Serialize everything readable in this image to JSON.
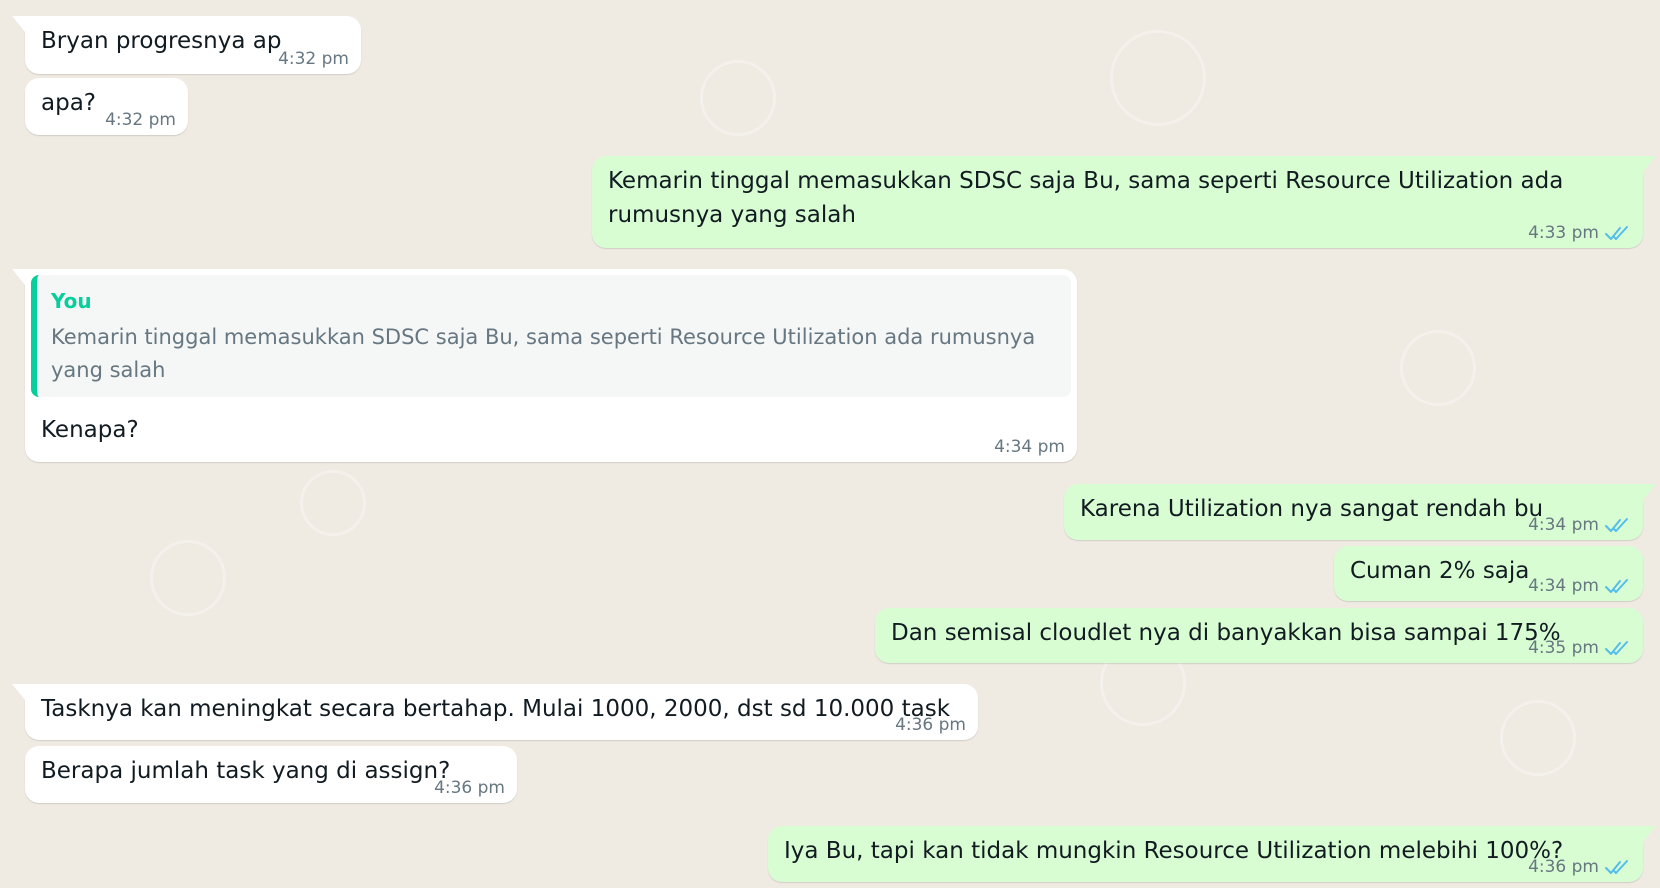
{
  "messages": [
    {
      "id": "m1",
      "direction": "incoming",
      "text": "Bryan progresnya ap",
      "time": "4:32 pm"
    },
    {
      "id": "m2",
      "direction": "incoming",
      "text": "apa?",
      "time": "4:32 pm"
    },
    {
      "id": "m3",
      "direction": "outgoing",
      "text": "Kemarin tinggal memasukkan SDSC saja Bu, sama seperti Resource Utilization ada rumusnya yang salah",
      "time": "4:33 pm",
      "status": "read"
    },
    {
      "id": "m4",
      "direction": "incoming",
      "text": "Kenapa?",
      "time": "4:34 pm",
      "quote": {
        "author": "You",
        "text": "Kemarin tinggal memasukkan SDSC saja Bu, sama seperti Resource Utilization ada rumusnya yang salah"
      }
    },
    {
      "id": "m5",
      "direction": "outgoing",
      "text": "Karena Utilization nya sangat rendah bu",
      "time": "4:34 pm",
      "status": "read"
    },
    {
      "id": "m6",
      "direction": "outgoing",
      "text": "Cuman 2% saja",
      "time": "4:34 pm",
      "status": "read"
    },
    {
      "id": "m7",
      "direction": "outgoing",
      "text": "Dan semisal cloudlet nya di banyakkan bisa sampai 175%",
      "time": "4:35 pm",
      "status": "read"
    },
    {
      "id": "m8",
      "direction": "incoming",
      "text": "Tasknya kan meningkat secara bertahap. Mulai 1000, 2000, dst sd 10.000 task",
      "time": "4:36 pm"
    },
    {
      "id": "m9",
      "direction": "incoming",
      "text": "Berapa jumlah task yang di assign?",
      "time": "4:36 pm"
    },
    {
      "id": "m10",
      "direction": "outgoing",
      "text": "Iya Bu, tapi kan tidak mungkin Resource Utilization melebihi 100%?",
      "time": "4:36 pm",
      "status": "read"
    }
  ],
  "colors": {
    "wallpaper": "#efeae2",
    "incoming_bubble": "#ffffff",
    "outgoing_bubble": "#d9fdd3",
    "read_check": "#53bdeb",
    "quote_accent": "#06cf9c",
    "meta_text": "#667781"
  },
  "icons": {
    "read_status": "double-check-icon"
  }
}
